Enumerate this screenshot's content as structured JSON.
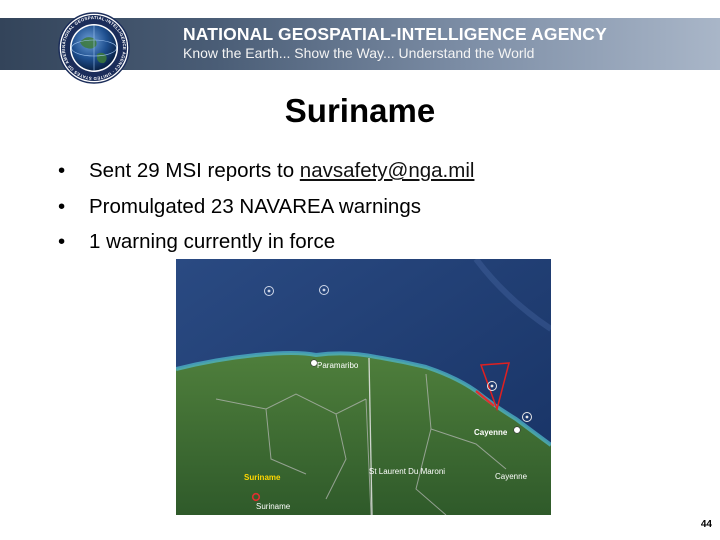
{
  "header": {
    "org_name": "NATIONAL GEOSPATIAL-INTELLIGENCE AGENCY",
    "tagline": "Know the Earth... Show the Way... Understand the World",
    "seal_text": "NATIONAL GEOSPATIAL-INTELLIGENCE AGENCY · UNITED STATES OF AMERICA",
    "colors": {
      "banner_dark": "#33445a",
      "banner_light": "#a9b6c8"
    }
  },
  "slide": {
    "title": "Suriname",
    "bullet_glyph": "•",
    "bullets": [
      {
        "prefix": "Sent 29 MSI reports to ",
        "link": "navsafety@nga.mil"
      },
      {
        "text": "Promulgated 23 NAVAREA warnings"
      },
      {
        "text": "1 warning currently in force"
      }
    ],
    "page_number": "44"
  },
  "map": {
    "labels": {
      "paramaribo": "Paramaribo",
      "cayenne_coast": "Cayenne",
      "st_laurent": "St Laurent Du Maroni",
      "cayenne_inland": "Cayenne",
      "suriname_region": "Suriname",
      "suriname_marker": "Suriname"
    },
    "colors": {
      "ocean": "#1f3d73",
      "land": "#3e6b35",
      "warning_area": "#e02020",
      "region_label": "#ffd700"
    }
  }
}
